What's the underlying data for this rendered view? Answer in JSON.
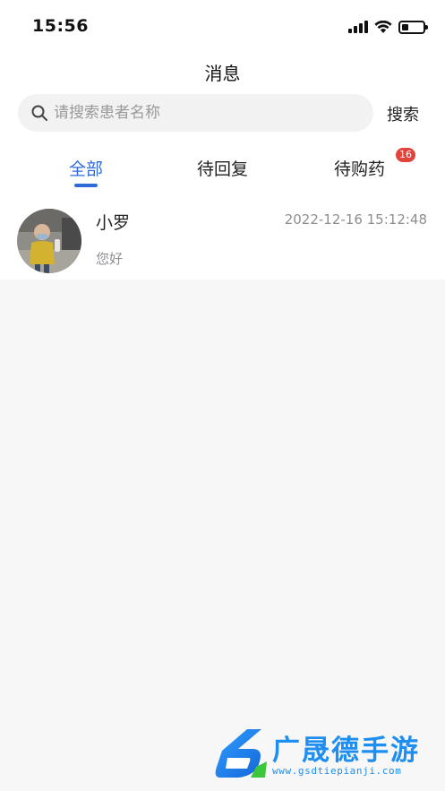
{
  "status_bar": {
    "time": "15:56",
    "signal_icon": "cellular-signal-icon",
    "wifi_icon": "wifi-icon",
    "battery_icon": "battery-icon",
    "battery_level": 0.25
  },
  "header": {
    "title": "消息"
  },
  "search": {
    "placeholder": "请搜索患者名称",
    "button_label": "搜索",
    "icon": "search-icon"
  },
  "tabs": [
    {
      "label": "全部",
      "active": true
    },
    {
      "label": "待回复",
      "active": false
    },
    {
      "label": "待购药",
      "active": false,
      "badge": "16"
    }
  ],
  "messages": [
    {
      "name": "小罗",
      "time": "2022-12-16 15:12:48",
      "preview": "您好",
      "avatar": "avatar-photo"
    }
  ],
  "watermark": {
    "text": "广晟德手游",
    "url": "www.gsdtiepianji.com"
  },
  "colors": {
    "accent": "#2f6bd8",
    "badge": "#e0443c",
    "watermark": "#1e8ef0"
  }
}
